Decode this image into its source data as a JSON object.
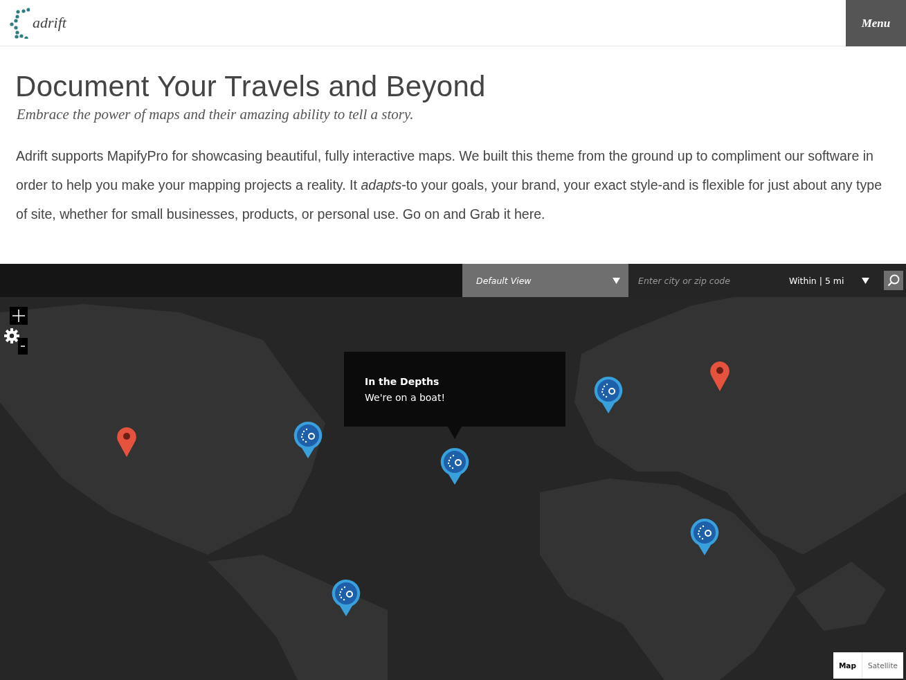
{
  "header": {
    "logo_text": "adrift",
    "menu_button": "Menu"
  },
  "intro": {
    "title": "Document Your Travels and Beyond",
    "subtitle": "Embrace the power of maps and their amazing ability to tell a story.",
    "body": "Adrift supports MapifyPro for showcasing beautiful, fully interactive maps. We built this theme from the ground up to compliment our software in order to help you make your mapping projects a reality. It *adapts*-to your goals, your brand, your exact style-and is flexible for just about any type of site, whether for small businesses, products, or personal use. Go on and Grab it here."
  },
  "map": {
    "toolbar": {
      "view_select": "Default View",
      "search_placeholder": "Enter city or zip code",
      "radius_select": "Within | 5 mi"
    },
    "popup": {
      "title": "In the Depths",
      "text": "We're on a boat!"
    },
    "pins": [
      {
        "kind": "default"
      },
      {
        "kind": "brand"
      },
      {
        "kind": "default"
      },
      {
        "kind": "brand"
      },
      {
        "kind": "brand"
      },
      {
        "kind": "brand"
      },
      {
        "kind": "brand"
      }
    ],
    "map_types": [
      {
        "label": "Map",
        "selected": true
      },
      {
        "label": "Satellite",
        "selected": false
      }
    ]
  }
}
